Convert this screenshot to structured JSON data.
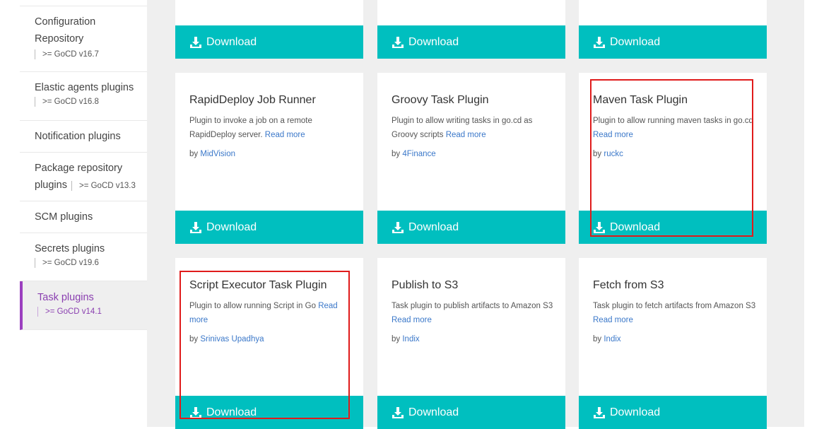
{
  "sidebar": {
    "items": [
      {
        "label": "Configuration",
        "label2": "Repository",
        "version": ">= GoCD v16.7"
      },
      {
        "label": "Elastic agents plugins",
        "version": ">= GoCD v16.8"
      },
      {
        "label": "Notification plugins"
      },
      {
        "label": "Package repository",
        "label2": "plugins",
        "version": ">= GoCD v13.3"
      },
      {
        "label": "SCM plugins"
      },
      {
        "label": "Secrets plugins",
        "version": ">= GoCD v19.6"
      },
      {
        "label": "Task plugins",
        "version": ">= GoCD v14.1",
        "active": true
      }
    ]
  },
  "download_label": "Download",
  "cards": [
    {
      "title": "RapidDeploy Job Runner",
      "desc": "Plugin to invoke a job on a remote RapidDeploy server.",
      "read_more": "Read more",
      "by": "by",
      "author": "MidVision"
    },
    {
      "title": "Groovy Task Plugin",
      "desc": "Plugin to allow writing tasks in go.cd as Groovy scripts",
      "read_more": "Read more",
      "by": "by",
      "author": "4Finance"
    },
    {
      "title": "Maven Task Plugin",
      "desc": "Plugin to allow running maven tasks in go.cd",
      "read_more": "Read more",
      "by": "by",
      "author": "ruckc"
    },
    {
      "title": "Script Executor Task Plugin",
      "desc": "Plugin to allow running Script in Go",
      "read_more": "Read more",
      "by": "by",
      "author": "Srinivas Upadhya"
    },
    {
      "title": "Publish to S3",
      "desc": "Task plugin to publish artifacts to Amazon S3",
      "read_more": "Read more",
      "by": "by",
      "author": "Indix"
    },
    {
      "title": "Fetch from S3",
      "desc": "Task plugin to fetch artifacts from Amazon S3",
      "read_more": "Read more",
      "by": "by",
      "author": "Indix"
    }
  ],
  "colors": {
    "accent": "#00bfbf",
    "active": "#9b3fbf",
    "link": "#3b78c9",
    "highlight": "#e01b1b"
  }
}
